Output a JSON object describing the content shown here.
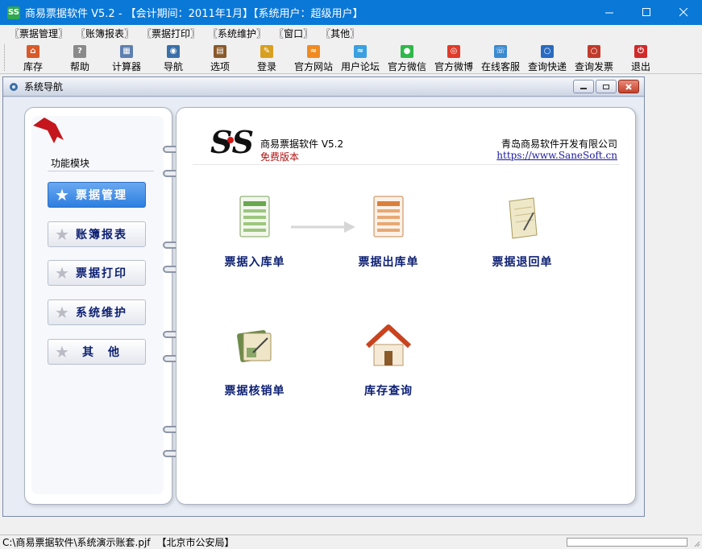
{
  "window": {
    "title": "商易票据软件 V5.2 - 【会计期间：2011年1月】【系统用户：超级用户】",
    "app_icon_text": "SS"
  },
  "menu": [
    "〖票据管理〗",
    "〖账簿报表〗",
    "〖票据打印〗",
    "〖系统维护〗",
    "〖窗口〗",
    "〖其他〗"
  ],
  "toolbar": [
    {
      "label": "库存",
      "icon": "house-icon",
      "color": "#d85a2a"
    },
    {
      "label": "帮助",
      "icon": "help-icon",
      "color": "#8a8a8a"
    },
    {
      "label": "计算器",
      "icon": "calculator-icon",
      "color": "#5f7fb0"
    },
    {
      "label": "导航",
      "icon": "navigation-icon",
      "color": "#3a6fa8"
    },
    {
      "label": "选项",
      "icon": "options-icon",
      "color": "#8a5a2a"
    },
    {
      "label": "登录",
      "icon": "key-icon",
      "color": "#d8a020"
    },
    {
      "label": "官方网站",
      "icon": "rss-icon",
      "color": "#f08a20"
    },
    {
      "label": "用户论坛",
      "icon": "forum-icon",
      "color": "#3aa0e0"
    },
    {
      "label": "官方微信",
      "icon": "wechat-icon",
      "color": "#2fb84a"
    },
    {
      "label": "官方微博",
      "icon": "weibo-icon",
      "color": "#e03a2a"
    },
    {
      "label": "在线客服",
      "icon": "support-icon",
      "color": "#3a8ad0"
    },
    {
      "label": "查询快递",
      "icon": "search-icon",
      "color": "#2a6ac0"
    },
    {
      "label": "查询发票",
      "icon": "search-invoice-icon",
      "color": "#c03a2a"
    },
    {
      "label": "退出",
      "icon": "exit-icon",
      "color": "#d02a2a"
    }
  ],
  "child_window": {
    "title": "系统导航"
  },
  "nav": {
    "module_title": "功能模块",
    "items": [
      {
        "label": "票据管理",
        "active": true
      },
      {
        "label": "账簿报表",
        "active": false
      },
      {
        "label": "票据打印",
        "active": false
      },
      {
        "label": "系统维护",
        "active": false
      },
      {
        "label": "其　他",
        "active": false
      }
    ]
  },
  "header": {
    "logo_text": "SS",
    "product": "商易票据软件 V5.2",
    "edition": "免费版本",
    "company": "青岛商易软件开发有限公司",
    "website": "https://www.SaneSoft.cn"
  },
  "functions": [
    {
      "label": "票据入库单",
      "icon": "green-ledger-icon"
    },
    {
      "label": "票据出库单",
      "icon": "orange-ledger-icon"
    },
    {
      "label": "票据退回单",
      "icon": "notepad-icon"
    },
    {
      "label": "票据核销单",
      "icon": "write-off-icon"
    },
    {
      "label": "库存查询",
      "icon": "house-icon"
    }
  ],
  "status": {
    "path": "C:\\商易票据软件\\系统演示账套.pjf",
    "unit": "【北京市公安局】"
  }
}
